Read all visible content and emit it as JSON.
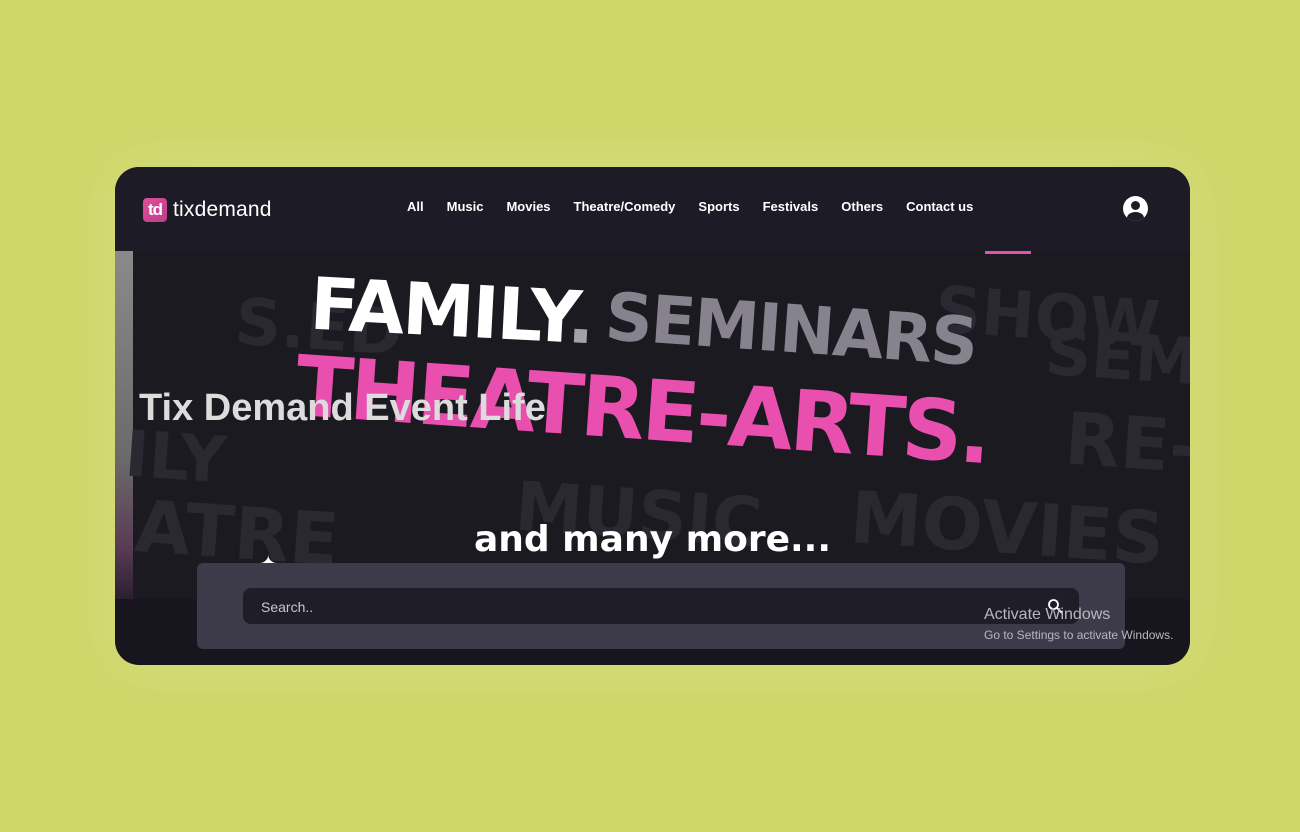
{
  "header": {
    "logo_mark": "td",
    "logo_text": "tixdemand",
    "nav": [
      "All",
      "Music",
      "Movies",
      "Theatre/Comedy",
      "Sports",
      "Festivals",
      "Others",
      "Contact us"
    ]
  },
  "hero": {
    "word_family": "FAMILY",
    "word_family_dot": ".",
    "word_seminars": "SEMINARS",
    "word_theatre": "THEATRE-ARTS.",
    "tagline": "Tix Demand Event Life",
    "many_more": "and many more...",
    "bg_words": [
      "S.ED",
      "SHOW",
      "SEM",
      "ILY",
      "RE-",
      "ATRE",
      "MUSIC",
      "MOVIES"
    ]
  },
  "search": {
    "placeholder": "Search.."
  },
  "watermark": {
    "title": "Activate Windows",
    "subtitle": "Go to Settings to activate Windows."
  },
  "colors": {
    "page_bg": "#cfd76a",
    "accent_pink": "#e94fae",
    "panel": "#3d3a4a"
  }
}
